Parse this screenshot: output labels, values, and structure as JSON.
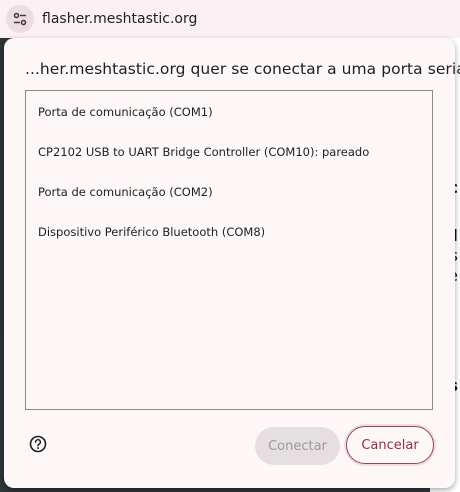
{
  "address_bar": {
    "url": "flasher.meshtastic.org",
    "site_icon": "tune-icon"
  },
  "dialog": {
    "title": "...her.meshtastic.org quer se conectar a uma porta serial",
    "ports": [
      "Porta de comunicação (COM1)",
      "CP2102 USB to UART Bridge Controller (COM10): pareado",
      "Porta de comunicação (COM2)",
      "Dispositivo Periférico Bluetooth (COM8)"
    ],
    "help_icon": "help-circle-icon",
    "connect_label": "Conectar",
    "cancel_label": "Cancelar"
  },
  "background": {
    "peek_letters": [
      "c",
      "l",
      "s",
      "e",
      "s"
    ]
  },
  "colors": {
    "topbar_bg": "#fbf0f3",
    "dialog_bg": "#fdf7f8",
    "accent": "#8f2f4b",
    "disabled_button": "#e5dfe1"
  }
}
